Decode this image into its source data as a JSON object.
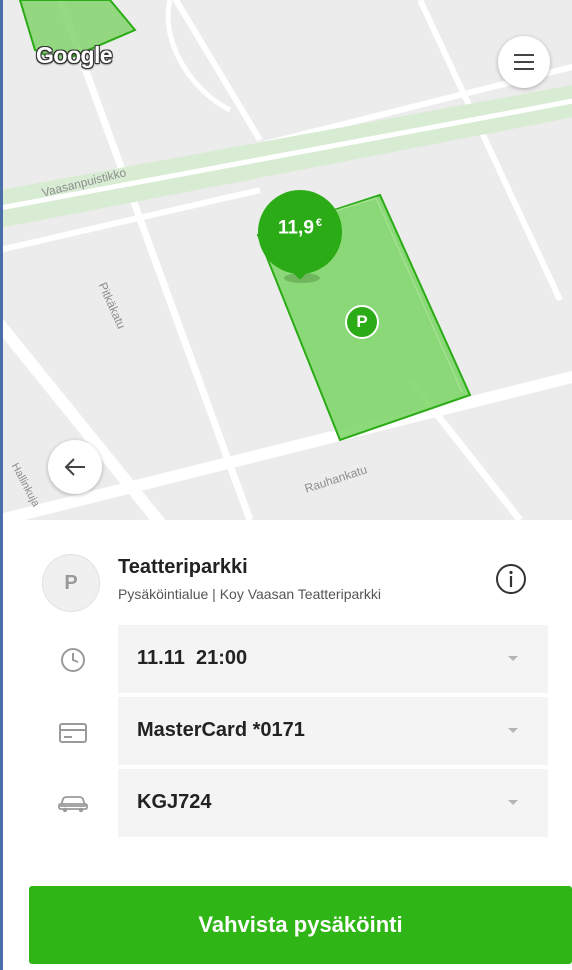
{
  "map": {
    "logo_text": "Google",
    "streets": {
      "vaasanpuistikko": "Vaasanpuistikko",
      "pitkakatu": "Pitkäkatu",
      "rauhankatu": "Rauhankatu",
      "hallinkuja": "Hallinkuja"
    },
    "price_pin": {
      "amount": "11,9",
      "currency": "€"
    },
    "parking_marker": "P",
    "icons": {
      "menu": "hamburger-menu-icon",
      "back": "arrow-left-icon"
    }
  },
  "lot": {
    "avatar_letter": "P",
    "name": "Teatteriparkki",
    "subtitle": "Pysäköintialue | Koy Vaasan Teatteriparkki",
    "info_icon": "info-icon"
  },
  "fields": {
    "time": {
      "icon": "clock-icon",
      "value": "11.11  21:00"
    },
    "payment": {
      "icon": "credit-card-icon",
      "value": "MasterCard *0171"
    },
    "vehicle": {
      "icon": "car-icon",
      "value": "KGJ724"
    }
  },
  "confirm_button": "Vahvista pysäköinti",
  "colors": {
    "accent_green": "#2fb516",
    "zone_fill": "#7fd66a",
    "map_bg": "#ececec",
    "field_bg": "#f4f4f4"
  }
}
